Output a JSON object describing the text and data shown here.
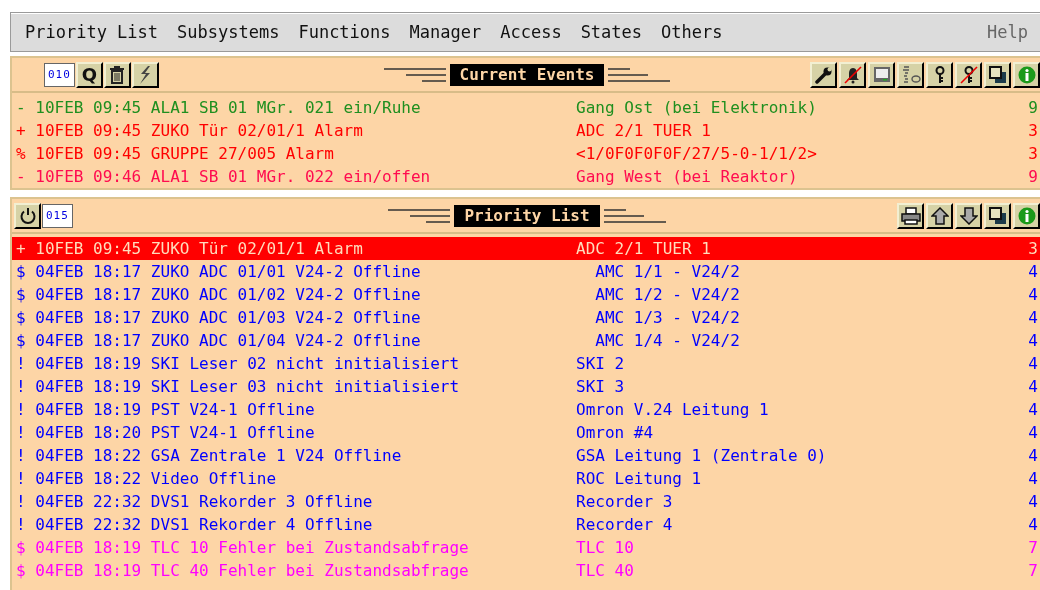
{
  "menu": [
    "Priority List",
    "Subsystems",
    "Functions",
    "Manager",
    "Access",
    "States",
    "Others"
  ],
  "help": "Help",
  "events_panel": {
    "title": "Current Events",
    "counter": "010",
    "query_button": "Q",
    "rows": [
      {
        "message": "- 10FEB 09:45 ALA1 SB 01 MGr. 021 ein/Ruhe",
        "location": "Gang Ost (bei Elektronik)",
        "column_3": "9",
        "color": "#1f8f1f"
      },
      {
        "message": "+ 10FEB 09:45 ZUKO Tür 02/01/1 Alarm",
        "location": "ADC 2/1 TUER 1",
        "column_3": "3",
        "color": "#ff0000"
      },
      {
        "message": "% 10FEB 09:45 GRUPPE 27/005 Alarm",
        "location": "<1/0F0F0F0F/27/5-0-1/1/2>",
        "column_3": "3",
        "color": "#ff0000"
      },
      {
        "message": "- 10FEB 09:46 ALA1 SB 01 MGr. 022 ein/offen",
        "location": "Gang West (bei Reaktor)",
        "column_3": "9",
        "color": "#ff0b4f"
      }
    ]
  },
  "priority_panel": {
    "title": "Priority List",
    "counter": "015",
    "rows": [
      {
        "message": "+ 10FEB 09:45 ZUKO Tür 02/01/1 Alarm",
        "location": "ADC 2/1 TUER 1",
        "column_3": "3",
        "color": "#ff0000",
        "selected": true
      },
      {
        "message": "$ 04FEB 18:17 ZUKO ADC 01/01 V24-2 Offline",
        "location": "  AMC 1/1 - V24/2",
        "column_3": "4",
        "color": "#0000ff",
        "selected": false
      },
      {
        "message": "$ 04FEB 18:17 ZUKO ADC 01/02 V24-2 Offline",
        "location": "  AMC 1/2 - V24/2",
        "column_3": "4",
        "color": "#0000ff",
        "selected": false
      },
      {
        "message": "$ 04FEB 18:17 ZUKO ADC 01/03 V24-2 Offline",
        "location": "  AMC 1/3 - V24/2",
        "column_3": "4",
        "color": "#0000ff",
        "selected": false
      },
      {
        "message": "$ 04FEB 18:17 ZUKO ADC 01/04 V24-2 Offline",
        "location": "  AMC 1/4 - V24/2",
        "column_3": "4",
        "color": "#0000ff",
        "selected": false
      },
      {
        "message": "! 04FEB 18:19 SKI Leser 02 nicht initialisiert",
        "location": "SKI 2",
        "column_3": "4",
        "color": "#0000ff",
        "selected": false
      },
      {
        "message": "! 04FEB 18:19 SKI Leser 03 nicht initialisiert",
        "location": "SKI 3",
        "column_3": "4",
        "color": "#0000ff",
        "selected": false
      },
      {
        "message": "! 04FEB 18:19 PST V24-1 Offline",
        "location": "Omron V.24 Leitung 1",
        "column_3": "4",
        "color": "#0000ff",
        "selected": false
      },
      {
        "message": "! 04FEB 18:20 PST V24-1 Offline",
        "location": "Omron #4",
        "column_3": "4",
        "color": "#0000ff",
        "selected": false
      },
      {
        "message": "! 04FEB 18:22 GSA Zentrale 1 V24 Offline",
        "location": "GSA Leitung 1 (Zentrale 0)",
        "column_3": "4",
        "color": "#0000ff",
        "selected": false
      },
      {
        "message": "! 04FEB 18:22 Video Offline",
        "location": "ROC Leitung 1",
        "column_3": "4",
        "color": "#0000ff",
        "selected": false
      },
      {
        "message": "! 04FEB 22:32 DVS1 Rekorder 3 Offline",
        "location": "Recorder 3",
        "column_3": "4",
        "color": "#0000ff",
        "selected": false
      },
      {
        "message": "! 04FEB 22:32 DVS1 Rekorder 4 Offline",
        "location": "Recorder 4",
        "column_3": "4",
        "color": "#0000ff",
        "selected": false
      },
      {
        "message": "$ 04FEB 18:19 TLC 10 Fehler bei Zustandsabfrage",
        "location": "TLC 10",
        "column_3": "7",
        "color": "#ff00ff",
        "selected": false
      },
      {
        "message": "$ 04FEB 18:19 TLC 40 Fehler bei Zustandsabfrage",
        "location": "TLC 40",
        "column_3": "7",
        "color": "#ff00ff",
        "selected": false
      }
    ]
  }
}
